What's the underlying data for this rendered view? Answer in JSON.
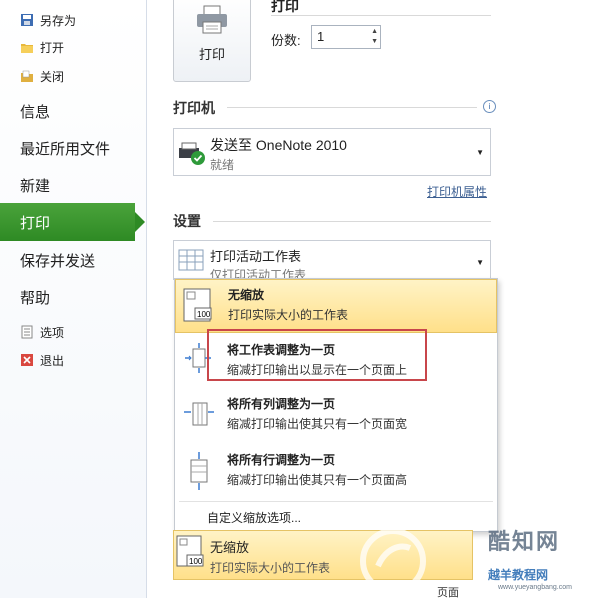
{
  "sidebar": {
    "small_items": [
      {
        "label": "另存为",
        "icon": "save-as-icon"
      },
      {
        "label": "打开",
        "icon": "open-folder-icon"
      },
      {
        "label": "关闭",
        "icon": "close-folder-icon"
      }
    ],
    "big_items": [
      "信息",
      "最近所用文件",
      "新建"
    ],
    "active_item": "打印",
    "big_items_after": [
      "保存并发送",
      "帮助"
    ],
    "bottom_items": [
      {
        "label": "选项",
        "icon": "options-icon"
      },
      {
        "label": "退出",
        "icon": "exit-icon"
      }
    ]
  },
  "print": {
    "button_label": "打印",
    "title": "打印",
    "copies_label": "份数:",
    "copies_value": "1"
  },
  "printer": {
    "section_title": "打印机",
    "name": "发送至 OneNote 2010",
    "status": "就绪",
    "properties_link": "打印机属性"
  },
  "settings": {
    "section_title": "设置",
    "current_title": "打印活动工作表",
    "current_desc": "仅打印活动工作表"
  },
  "scaling_menu": {
    "items": [
      {
        "title": "无缩放",
        "desc": "打印实际大小的工作表",
        "selected": true
      },
      {
        "title": "将工作表调整为一页",
        "desc": "缩减打印输出以显示在一个页面上",
        "selected": false
      },
      {
        "title": "将所有列调整为一页",
        "desc": "缩减打印输出使其只有一个页面宽",
        "selected": false
      },
      {
        "title": "将所有行调整为一页",
        "desc": "缩减打印输出使其只有一个页面高",
        "selected": false
      }
    ],
    "custom_option": "自定义缩放选项..."
  },
  "scaling_selected": {
    "title": "无缩放",
    "desc": "打印实际大小的工作表"
  },
  "page_setup_label": "页面",
  "watermark": {
    "brand": "酷知网",
    "subtitle": "越羊教程网",
    "url": "www.yueyangbang.com"
  },
  "colors": {
    "active_green": "#3a962d",
    "highlight_yellow": "#ffe08a",
    "annotation_red": "#c8464b"
  }
}
